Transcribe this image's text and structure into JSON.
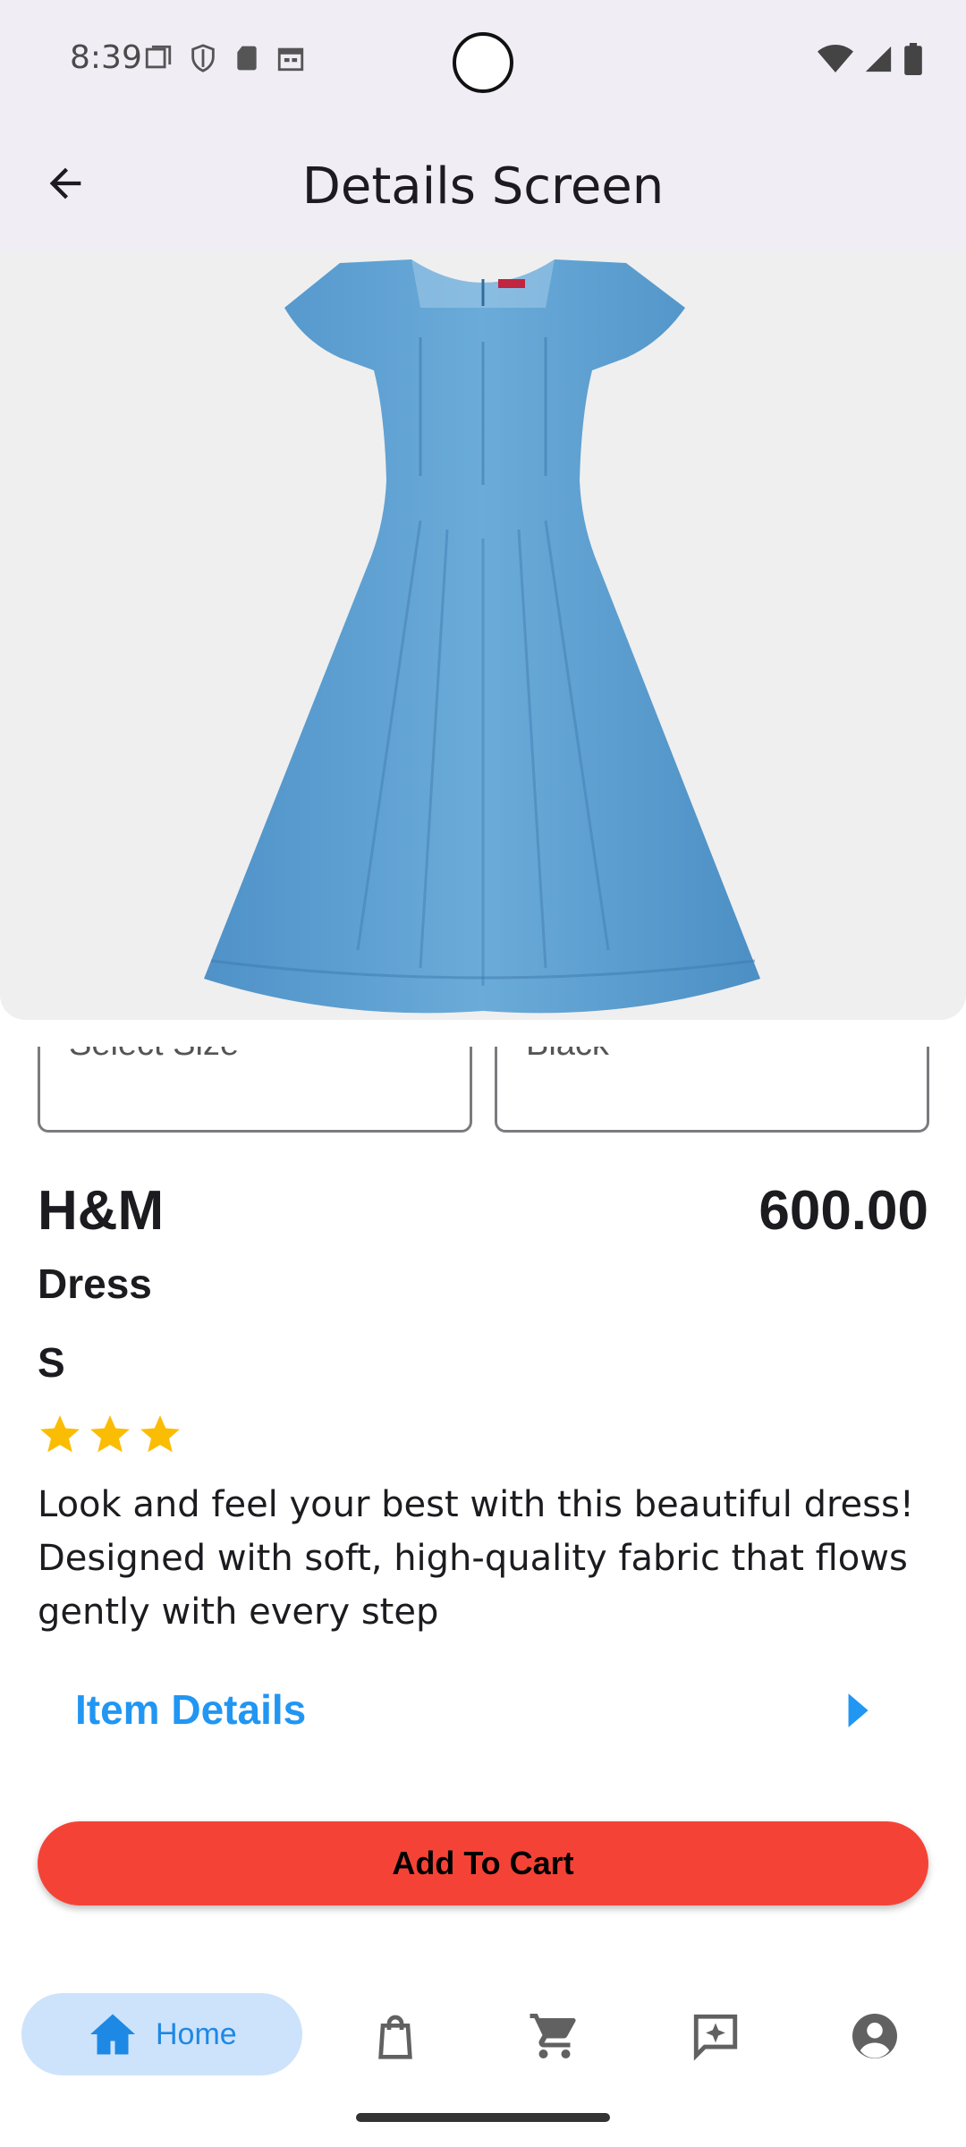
{
  "status_bar": {
    "time": "8:39"
  },
  "app_bar": {
    "title": "Details Screen"
  },
  "selectors": {
    "size_placeholder": "Select Size",
    "color_value": "Black"
  },
  "product": {
    "brand": "H&M",
    "price": "600.00",
    "type": "Dress",
    "size": "S",
    "rating": 3,
    "description": "Look and feel your best with this beautiful dress! Designed with soft, high-quality fabric that flows gently with every step"
  },
  "item_details": {
    "label": "Item Details"
  },
  "add_to_cart": {
    "label": "Add To Cart"
  },
  "bottom_nav": {
    "items": [
      {
        "label": "Home",
        "icon": "home-icon",
        "active": true
      },
      {
        "icon": "shopping-bag-icon"
      },
      {
        "icon": "cart-icon"
      },
      {
        "icon": "chat-sparkle-icon"
      },
      {
        "icon": "account-icon"
      }
    ]
  },
  "colors": {
    "accent": "#2196f3",
    "cart_button": "#f44336",
    "star": "#fbbc04",
    "app_bar_bg": "#f1edf5",
    "nav_active_bg": "#cde3fb"
  }
}
